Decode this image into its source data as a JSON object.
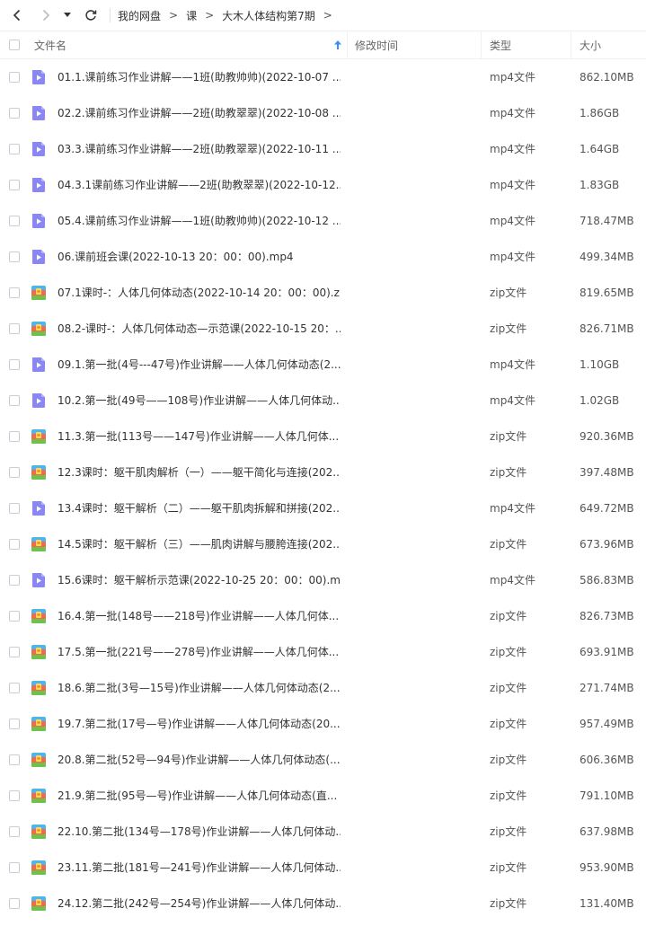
{
  "breadcrumb": [
    "我的网盘",
    "课",
    "大木人体结构第7期"
  ],
  "breadcrumb_sep": ">",
  "header": {
    "name": "文件名",
    "modified": "修改时间",
    "type": "类型",
    "size": "大小"
  },
  "colors": {
    "video_icon": "#8a87f2",
    "zip_icon_top": "#4db5ef",
    "zip_icon_bottom": "#f26a4a",
    "sort_arrow": "#3b8cf5"
  },
  "files": [
    {
      "icon": "video-file-icon",
      "name": "01.1.课前练习作业讲解——1班(助教帅帅)(2022-10-07 ...",
      "type": "mp4文件",
      "size": "862.10MB"
    },
    {
      "icon": "video-file-icon",
      "name": "02.2.课前练习作业讲解——2班(助教翠翠)(2022-10-08 ...",
      "type": "mp4文件",
      "size": "1.86GB"
    },
    {
      "icon": "video-file-icon",
      "name": "03.3.课前练习作业讲解——2班(助教翠翠)(2022-10-11 ...",
      "type": "mp4文件",
      "size": "1.64GB"
    },
    {
      "icon": "video-file-icon",
      "name": "04.3.1课前练习作业讲解——2班(助教翠翠)(2022-10-12...",
      "type": "mp4文件",
      "size": "1.83GB"
    },
    {
      "icon": "video-file-icon",
      "name": "05.4.课前练习作业讲解——1班(助教帅帅)(2022-10-12 ...",
      "type": "mp4文件",
      "size": "718.47MB"
    },
    {
      "icon": "video-file-icon",
      "name": "06.课前班会课(2022-10-13 20：00：00).mp4",
      "type": "mp4文件",
      "size": "499.34MB"
    },
    {
      "icon": "zip-file-icon",
      "name": "07.1课时-：人体几何体动态(2022-10-14 20：00：00).zip",
      "type": "zip文件",
      "size": "819.65MB"
    },
    {
      "icon": "zip-file-icon",
      "name": "08.2-课时-：人体几何体动态—示范课(2022-10-15 20：...",
      "type": "zip文件",
      "size": "826.71MB"
    },
    {
      "icon": "video-file-icon",
      "name": "09.1.第一批(4号---47号)作业讲解——人体几何体动态(2...",
      "type": "mp4文件",
      "size": "1.10GB"
    },
    {
      "icon": "video-file-icon",
      "name": "10.2.第一批(49号——108号)作业讲解——人体几何体动...",
      "type": "mp4文件",
      "size": "1.02GB"
    },
    {
      "icon": "zip-file-icon",
      "name": "11.3.第一批(113号——147号)作业讲解——人体几何体...",
      "type": "zip文件",
      "size": "920.36MB"
    },
    {
      "icon": "zip-file-icon",
      "name": "12.3课时：躯干肌肉解析（一）——躯干简化与连接(202...",
      "type": "zip文件",
      "size": "397.48MB"
    },
    {
      "icon": "video-file-icon",
      "name": "13.4课时：躯干解析（二）——躯干肌肉拆解和拼接(202...",
      "type": "mp4文件",
      "size": "649.72MB"
    },
    {
      "icon": "zip-file-icon",
      "name": "14.5课时：躯干解析（三）——肌肉讲解与腰胯连接(202...",
      "type": "zip文件",
      "size": "673.96MB"
    },
    {
      "icon": "video-file-icon",
      "name": "15.6课时：躯干解析示范课(2022-10-25 20：00：00).m...",
      "type": "mp4文件",
      "size": "586.83MB"
    },
    {
      "icon": "zip-file-icon",
      "name": "16.4.第一批(148号——218号)作业讲解——人体几何体...",
      "type": "zip文件",
      "size": "826.73MB"
    },
    {
      "icon": "zip-file-icon",
      "name": "17.5.第一批(221号——278号)作业讲解——人体几何体...",
      "type": "zip文件",
      "size": "693.91MB"
    },
    {
      "icon": "zip-file-icon",
      "name": "18.6.第二批(3号—15号)作业讲解——人体几何体动态(2...",
      "type": "zip文件",
      "size": "271.74MB"
    },
    {
      "icon": "zip-file-icon",
      "name": "19.7.第二批(17号—号)作业讲解——人体几何体动态(20...",
      "type": "zip文件",
      "size": "957.49MB"
    },
    {
      "icon": "zip-file-icon",
      "name": "20.8.第二批(52号—94号)作业讲解——人体几何体动态(...",
      "type": "zip文件",
      "size": "606.36MB"
    },
    {
      "icon": "zip-file-icon",
      "name": "21.9.第二批(95号—号)作业讲解——人体几何体动态(直...",
      "type": "zip文件",
      "size": "791.10MB"
    },
    {
      "icon": "zip-file-icon",
      "name": "22.10.第二批(134号—178号)作业讲解——人体几何体动...",
      "type": "zip文件",
      "size": "637.98MB"
    },
    {
      "icon": "zip-file-icon",
      "name": "23.11.第二批(181号—241号)作业讲解——人体几何体动...",
      "type": "zip文件",
      "size": "953.90MB"
    },
    {
      "icon": "zip-file-icon",
      "name": "24.12.第二批(242号—254号)作业讲解——人体几何体动...",
      "type": "zip文件",
      "size": "131.40MB"
    }
  ]
}
